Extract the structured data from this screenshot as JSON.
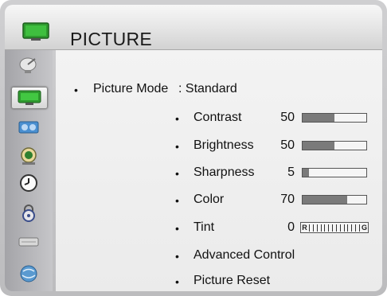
{
  "header": {
    "title": "PICTURE",
    "icon": "tv-icon"
  },
  "sidebar": {
    "items": [
      {
        "icon": "satellite-dish-icon",
        "selected": false
      },
      {
        "icon": "tv-icon",
        "selected": true
      },
      {
        "icon": "speaker-icon",
        "selected": false
      },
      {
        "icon": "target-icon",
        "selected": false
      },
      {
        "icon": "clock-icon",
        "selected": false
      },
      {
        "icon": "lock-icon",
        "selected": false
      },
      {
        "icon": "keyboard-icon",
        "selected": false
      },
      {
        "icon": "globe-icon",
        "selected": false
      }
    ]
  },
  "menu": {
    "picture_mode_label": "Picture Mode",
    "picture_mode_value": ": Standard",
    "items": [
      {
        "label": "Contrast",
        "value": "50",
        "level": 0.5
      },
      {
        "label": "Brightness",
        "value": "50",
        "level": 0.5
      },
      {
        "label": "Sharpness",
        "value": "5",
        "level": 0.1
      },
      {
        "label": "Color",
        "value": "70",
        "level": 0.7
      },
      {
        "label": "Tint",
        "value": "0",
        "left_mark": "R",
        "right_mark": "G"
      }
    ],
    "advanced_control": "Advanced Control",
    "picture_reset": "Picture Reset",
    "bullet": "•"
  },
  "colors": {
    "accent_green": "#2f9a2f",
    "bar_fill": "#7a7a7a"
  }
}
